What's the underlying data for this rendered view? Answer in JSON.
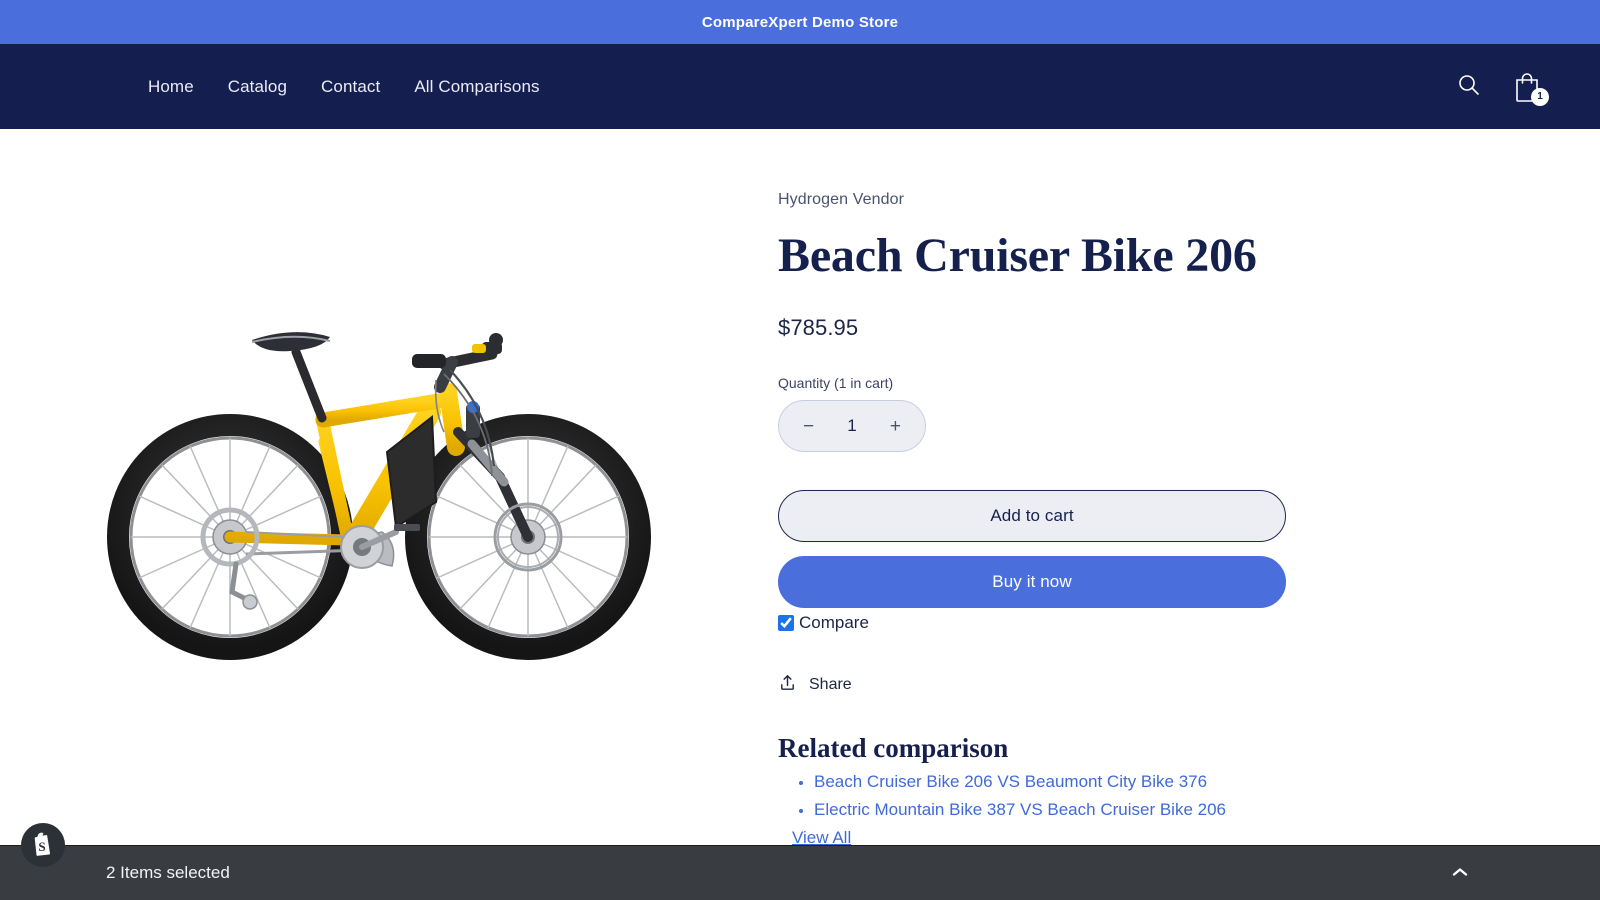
{
  "announcement": {
    "text": "CompareXpert Demo Store"
  },
  "header": {
    "nav": [
      {
        "label": "Home"
      },
      {
        "label": "Catalog"
      },
      {
        "label": "Contact"
      },
      {
        "label": "All Comparisons"
      }
    ],
    "search_icon": "search-icon",
    "cart_icon": "shopping-bag-icon",
    "cart_count": "1"
  },
  "product": {
    "vendor": "Hydrogen Vendor",
    "title": "Beach Cruiser Bike 206",
    "price": "$785.95",
    "quantity_label": "Quantity (1 in cart)",
    "quantity_value": "1",
    "decrease_label": "−",
    "increase_label": "+",
    "add_to_cart_label": "Add to cart",
    "buy_now_label": "Buy it now",
    "compare_label": "Compare",
    "compare_checked": true,
    "share_label": "Share",
    "image_alt": "Yellow electric mountain bike"
  },
  "related": {
    "heading": "Related comparison",
    "items": [
      {
        "label": "Beach Cruiser Bike 206 VS Beaumont City Bike 376"
      },
      {
        "label": "Electric Mountain Bike 387 VS Beach Cruiser Bike 206"
      }
    ],
    "view_all_label": "View All"
  },
  "bottom_bar": {
    "selected_text": "2 Items selected",
    "collapse_icon": "chevron-up-icon"
  },
  "colors": {
    "announce_bg": "#4a6fdc",
    "header_bg": "#141f4f",
    "accent": "#4a6fdc",
    "link": "#3f6ad8",
    "title": "#16204d",
    "bottom_bar_bg": "#393d41",
    "checkbox": "#1a73e8"
  }
}
